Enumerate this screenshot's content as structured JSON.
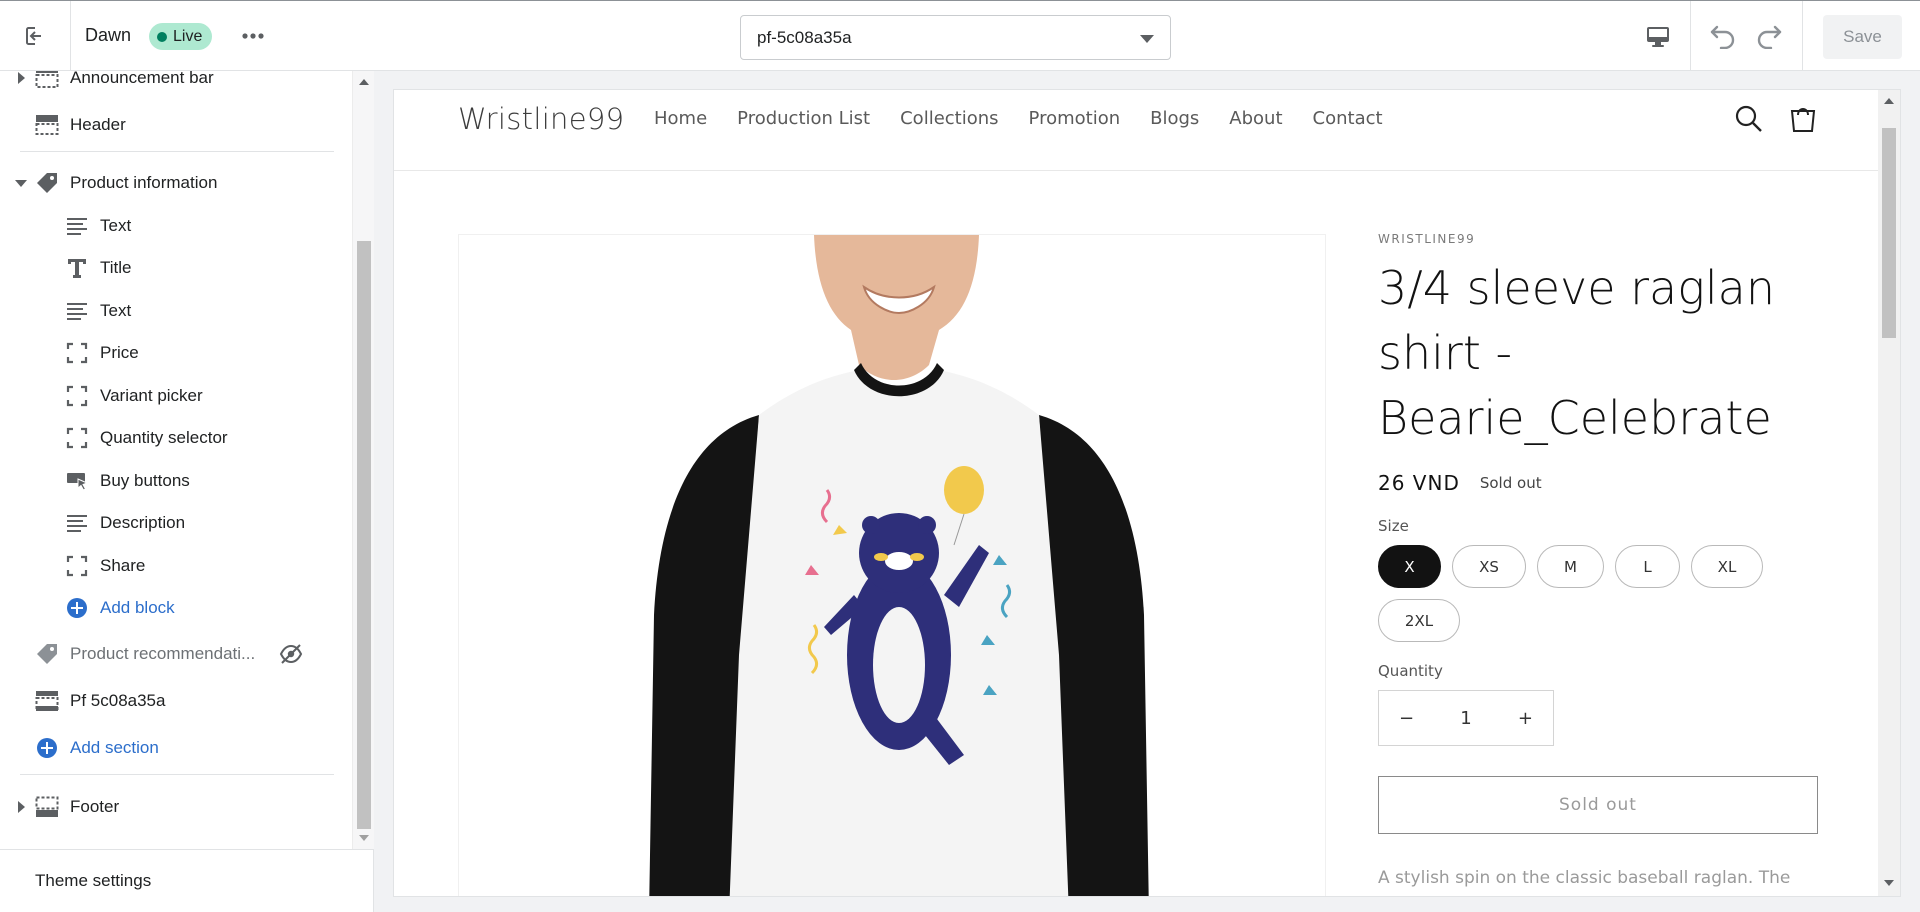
{
  "topbar": {
    "theme_name": "Dawn",
    "live_badge": "Live",
    "template_select": "pf-5c08a35a",
    "save_label": "Save"
  },
  "sidebar": {
    "items": [
      {
        "label": "Announcement bar",
        "icon": "section-icon"
      },
      {
        "label": "Header",
        "icon": "header-icon"
      },
      {
        "label": "Product information",
        "icon": "tag-icon"
      },
      {
        "label": "Text",
        "icon": "text-lines-icon"
      },
      {
        "label": "Title",
        "icon": "title-t-icon"
      },
      {
        "label": "Text",
        "icon": "text-lines-icon"
      },
      {
        "label": "Price",
        "icon": "block-dashed-icon"
      },
      {
        "label": "Variant picker",
        "icon": "block-dashed-icon"
      },
      {
        "label": "Quantity selector",
        "icon": "block-dashed-icon"
      },
      {
        "label": "Buy buttons",
        "icon": "buy-buttons-icon"
      },
      {
        "label": "Description",
        "icon": "text-lines-icon"
      },
      {
        "label": "Share",
        "icon": "block-dashed-icon"
      },
      {
        "label": "Add block",
        "icon": "plus-circle-icon"
      },
      {
        "label": "Product recommendati...",
        "icon": "tag-icon"
      },
      {
        "label": "Pf 5c08a35a",
        "icon": "section-icon"
      },
      {
        "label": "Add section",
        "icon": "plus-circle-icon"
      },
      {
        "label": "Footer",
        "icon": "footer-icon"
      }
    ],
    "footer_label": "Theme settings"
  },
  "preview": {
    "logo": "Wristline99",
    "nav": [
      "Home",
      "Production List",
      "Collections",
      "Promotion",
      "Blogs",
      "About",
      "Contact"
    ],
    "vendor": "WRISTLINE99",
    "title": "3/4 sleeve raglan shirt - Bearie_Celebrate",
    "price": "26 VND",
    "badge": "Sold out",
    "size_label": "Size",
    "sizes": [
      "X",
      "XS",
      "M",
      "L",
      "XL",
      "2XL"
    ],
    "selected_size": "X",
    "quantity_label": "Quantity",
    "quantity": "1",
    "qty_minus": "−",
    "qty_plus": "+",
    "button_label": "Sold out",
    "description_preview": "A stylish spin on the classic baseball raglan. The"
  },
  "colors": {
    "accent": "#2c6ecb",
    "live_badge": "#aee9d1",
    "live_dot": "#007f5f"
  }
}
